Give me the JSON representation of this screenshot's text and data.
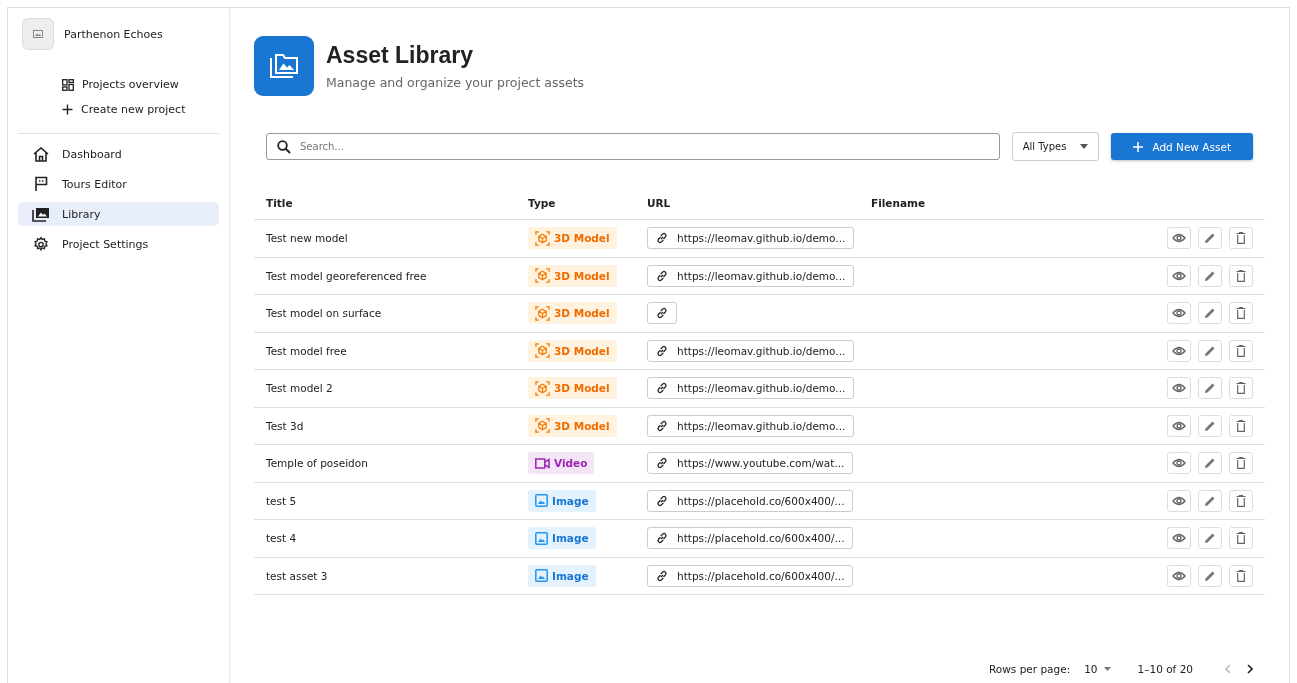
{
  "project": {
    "name": "Parthenon Echoes"
  },
  "project_menu": [
    {
      "label": "Projects overview",
      "kind": "overview"
    },
    {
      "label": "Create new project",
      "kind": "create"
    }
  ],
  "nav": [
    {
      "label": "Dashboard",
      "kind": "dashboard",
      "selected": false
    },
    {
      "label": "Tours Editor",
      "kind": "tours",
      "selected": false
    },
    {
      "label": "Library",
      "kind": "library",
      "selected": true
    },
    {
      "label": "Project Settings",
      "kind": "settings",
      "selected": false
    }
  ],
  "header": {
    "title": "Asset Library",
    "subtitle": "Manage and organize your project assets"
  },
  "search": {
    "placeholder": "Search..."
  },
  "type_filter": {
    "value": "All Types"
  },
  "add_button": {
    "label": "Add New Asset"
  },
  "table": {
    "columns": [
      "Title",
      "Type",
      "URL",
      "Filename"
    ],
    "rows": [
      {
        "title": "Test new model",
        "type": {
          "kind": "model",
          "label": "3D Model"
        },
        "url": "https://leomav.github.io/demo..."
      },
      {
        "title": "Test model georeferenced free",
        "type": {
          "kind": "model",
          "label": "3D Model"
        },
        "url": "https://leomav.github.io/demo..."
      },
      {
        "title": "Test model on surface",
        "type": {
          "kind": "model",
          "label": "3D Model"
        },
        "url": ""
      },
      {
        "title": "Test model free",
        "type": {
          "kind": "model",
          "label": "3D Model"
        },
        "url": "https://leomav.github.io/demo..."
      },
      {
        "title": "Test model 2",
        "type": {
          "kind": "model",
          "label": "3D Model"
        },
        "url": "https://leomav.github.io/demo..."
      },
      {
        "title": "Test 3d",
        "type": {
          "kind": "model",
          "label": "3D Model"
        },
        "url": "https://leomav.github.io/demo..."
      },
      {
        "title": "Temple of poseidon",
        "type": {
          "kind": "video",
          "label": "Video"
        },
        "url": "https://www.youtube.com/wat..."
      },
      {
        "title": "test 5",
        "type": {
          "kind": "image",
          "label": "Image"
        },
        "url": "https://placehold.co/600x400/..."
      },
      {
        "title": "test 4",
        "type": {
          "kind": "image",
          "label": "Image"
        },
        "url": "https://placehold.co/600x400/..."
      },
      {
        "title": "test asset 3",
        "type": {
          "kind": "image",
          "label": "Image"
        },
        "url": "https://placehold.co/600x400/..."
      }
    ]
  },
  "pagination": {
    "rows_per_page_label": "Rows per page:",
    "rows_per_page": "10",
    "range": "1–10 of 20",
    "prev_disabled": true,
    "next_disabled": false
  }
}
